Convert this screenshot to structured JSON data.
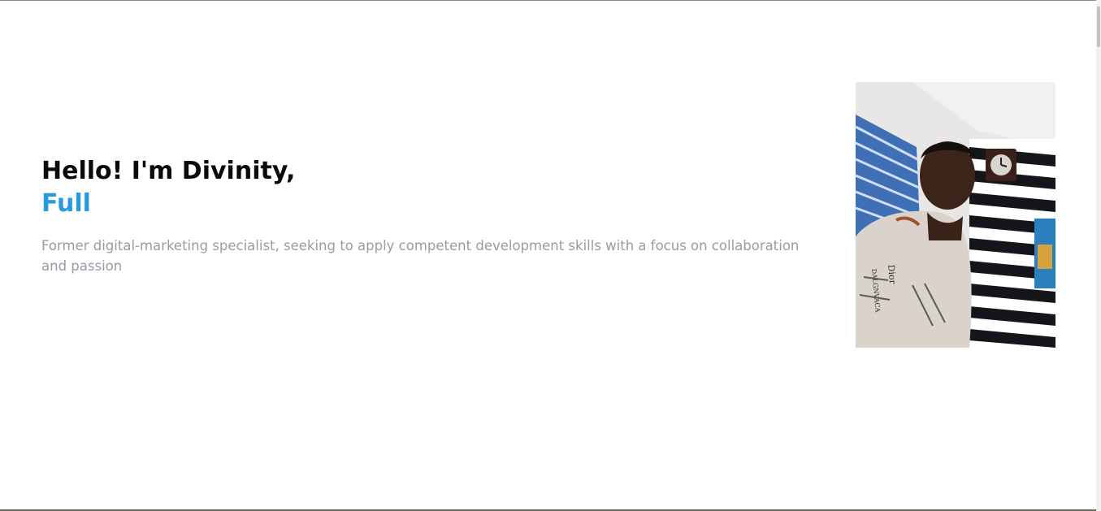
{
  "hero": {
    "greeting": "Hello! I'm Divinity,",
    "role": "Full",
    "description": "Former digital-marketing specialist, seeking to apply competent development skills with a focus on collaboration and passion"
  },
  "colors": {
    "accent": "#2a9ae0",
    "heading": "#0a0a0a",
    "muted_text": "#9a9aa6",
    "background": "#ffffff"
  }
}
